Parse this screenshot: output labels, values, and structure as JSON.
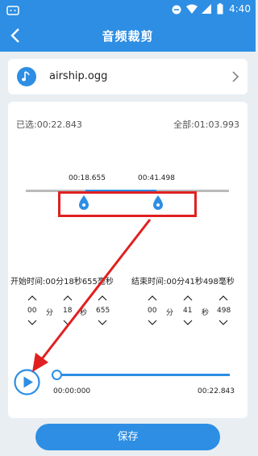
{
  "status": {
    "time": "4:40"
  },
  "header": {
    "title": "音频裁剪"
  },
  "file": {
    "name": "airship.ogg"
  },
  "selection": {
    "selected": "已选:00:22.843",
    "total": "全部:01:03.993"
  },
  "markers": {
    "start_time": "00:18.655",
    "end_time": "00:41.498"
  },
  "start": {
    "label": "开始时间:00分18秒655毫秒",
    "min": "00",
    "min_unit": "分",
    "sec": "18",
    "sec_unit": "秒",
    "ms": "655"
  },
  "end": {
    "label": "结束时间:00分41秒498毫秒",
    "min": "00",
    "min_unit": "分",
    "sec": "41",
    "sec_unit": "秒",
    "ms": "498"
  },
  "player": {
    "current": "00:00:000",
    "duration": "00:22.843"
  },
  "actions": {
    "save": "保存"
  },
  "colors": {
    "primary": "#2d8ee4",
    "annotation": "#e02020"
  }
}
